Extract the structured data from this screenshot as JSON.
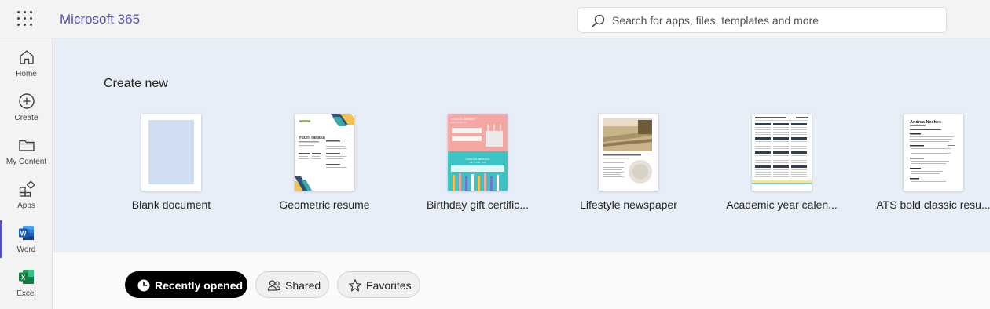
{
  "header": {
    "app_title": "Microsoft 365",
    "search_placeholder": "Search for apps, files, templates and more",
    "accent_color": "#4f52b2"
  },
  "rail": {
    "items": [
      {
        "label": "Home",
        "icon": "home-icon"
      },
      {
        "label": "Create",
        "icon": "plus-circle-icon"
      },
      {
        "label": "My Content",
        "icon": "folder-icon"
      },
      {
        "label": "Apps",
        "icon": "apps-icon"
      },
      {
        "label": "Word",
        "icon": "word-icon",
        "active": true
      },
      {
        "label": "Excel",
        "icon": "excel-icon"
      }
    ]
  },
  "create": {
    "title": "Create new",
    "templates": [
      {
        "name": "Blank document"
      },
      {
        "name": "Geometric resume"
      },
      {
        "name": "Birthday gift certific..."
      },
      {
        "name": "Lifestyle newspaper"
      },
      {
        "name": "Academic year calen..."
      },
      {
        "name": "ATS bold classic resu..."
      }
    ],
    "thumb_text": {
      "resume_name": "Yuuri Tanaka",
      "gift_line": "A SPECIAL BIRTHDAY GIFT FOR YOU",
      "ats_name": "Andrea Neches"
    }
  },
  "filters": {
    "recent": "Recently opened",
    "shared": "Shared",
    "favorites": "Favorites"
  }
}
